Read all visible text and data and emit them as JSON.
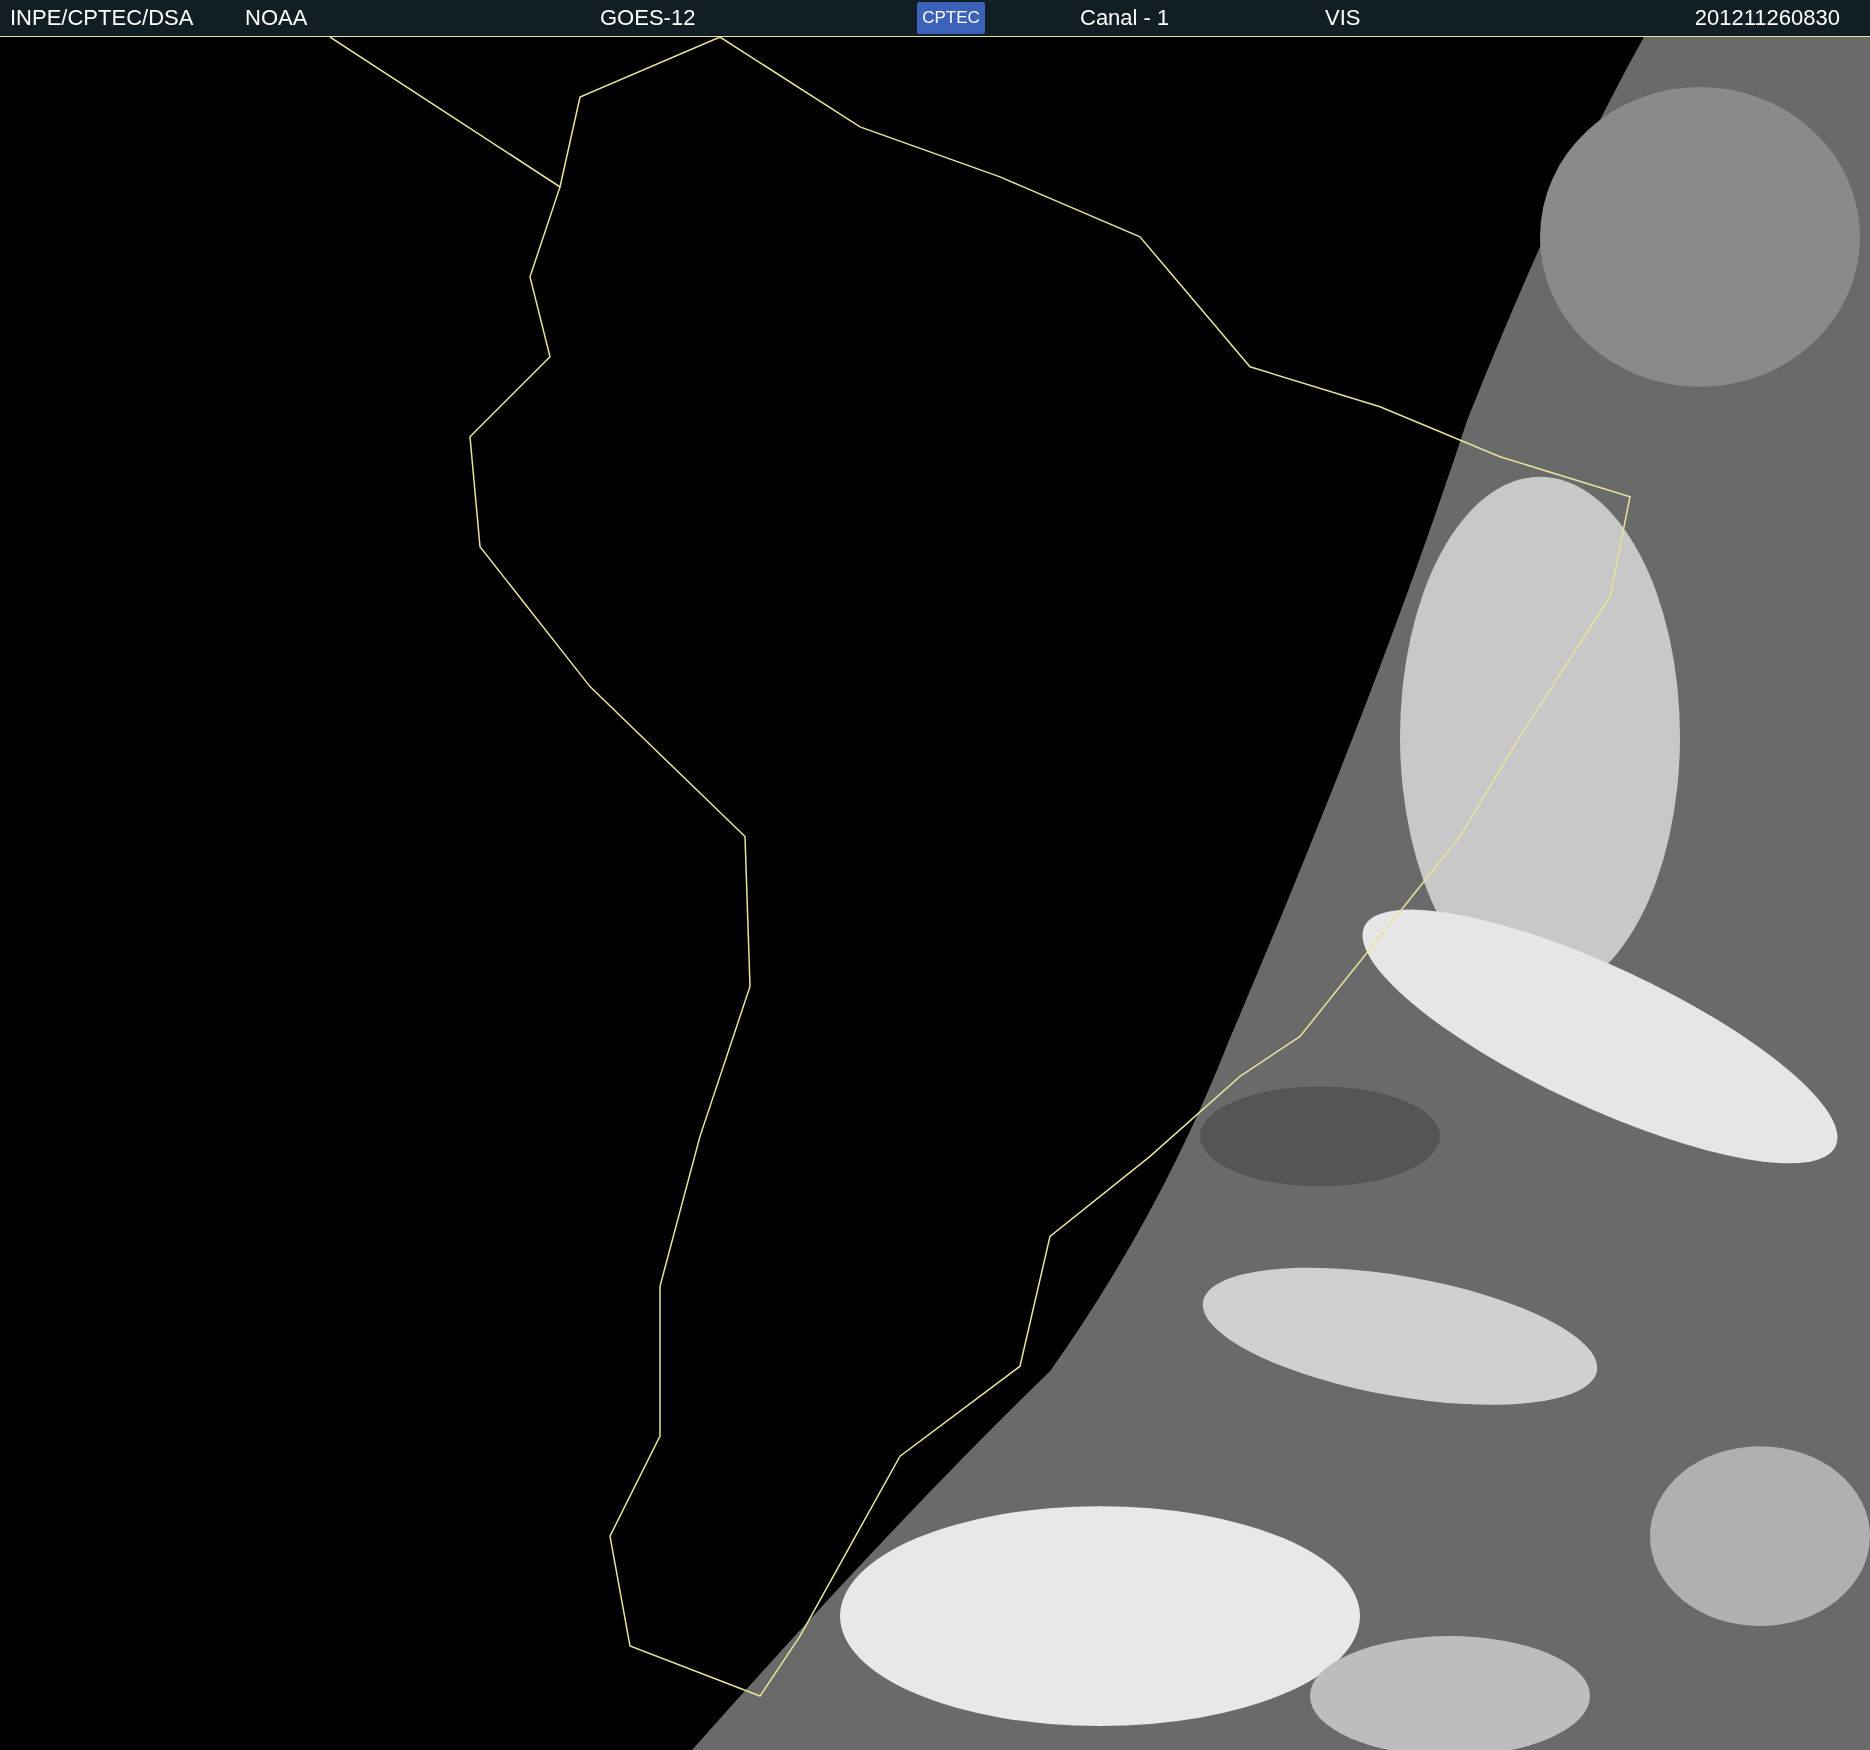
{
  "header": {
    "source": "INPE/CPTEC/DSA",
    "agency": "NOAA",
    "satellite": "GOES-12",
    "logo_text": "CPTEC",
    "channel": "Canal - 1",
    "band": "VIS",
    "timestamp": "201211260830"
  }
}
